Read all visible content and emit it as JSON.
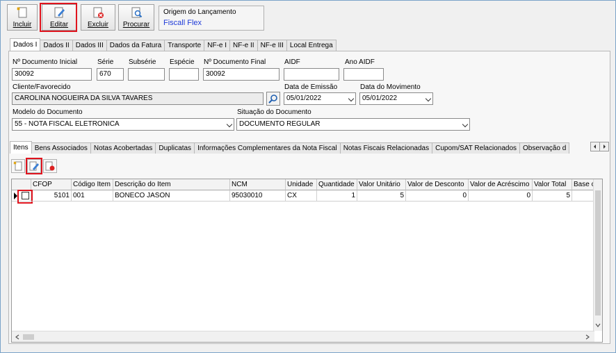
{
  "toolbar": {
    "incluir_label": "Incluir",
    "editar_label": "Editar",
    "excluir_label": "Excluir",
    "procurar_label": "Procurar"
  },
  "origem": {
    "title": "Origem do Lançamento",
    "value": "Fiscall Flex"
  },
  "top_tabs": [
    "Dados I",
    "Dados II",
    "Dados III",
    "Dados da Fatura",
    "Transporte",
    "NF-e I",
    "NF-e II",
    "NF-e III",
    "Local Entrega"
  ],
  "form": {
    "num_doc_inicial_label": "Nº Documento Inicial",
    "num_doc_inicial": "30092",
    "serie_label": "Série",
    "serie": "670",
    "subserie_label": "Subsérie",
    "subserie": "",
    "especie_label": "Espécie",
    "especie": "",
    "num_doc_final_label": "Nº Documento Final",
    "num_doc_final": "30092",
    "aidf_label": "AIDF",
    "aidf": "",
    "ano_aidf_label": "Ano AIDF",
    "ano_aidf": "",
    "cliente_label": "Cliente/Favorecido",
    "cliente": "CAROLINA NOGUEIRA DA SILVA TAVARES",
    "data_emissao_label": "Data de Emissão",
    "data_emissao": "05/01/2022",
    "data_movimento_label": "Data do Movimento",
    "data_movimento": "05/01/2022",
    "modelo_label": "Modelo do Documento",
    "modelo": "55 - NOTA FISCAL ELETRONICA",
    "situacao_label": "Situação do Documento",
    "situacao": "DOCUMENTO REGULAR"
  },
  "bottom_tabs": [
    "Itens",
    "Bens Associados",
    "Notas Acobertadas",
    "Duplicatas",
    "Informações Complementares da Nota Fiscal",
    "Notas Fiscais Relacionadas",
    "Cupom/SAT Relacionados",
    "Observação d"
  ],
  "grid": {
    "columns": [
      "CFOP",
      "Código Item",
      "Descrição do Item",
      "NCM",
      "Unidade",
      "Quantidade",
      "Valor Unitário",
      "Valor de Desconto",
      "Valor de Acréscimo",
      "Valor Total",
      "Base c"
    ],
    "rows": [
      [
        "5101",
        "001",
        "BONECO JASON",
        "95030010",
        "CX",
        "1",
        "5",
        "0",
        "0",
        "5",
        ""
      ]
    ]
  },
  "colors": {
    "highlight": "#e0141e",
    "origem_value": "#1e3ad8"
  }
}
